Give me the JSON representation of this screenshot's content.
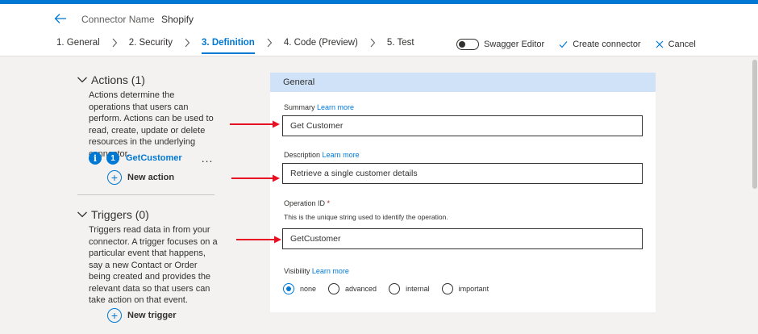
{
  "header": {
    "connector_name_label": "Connector Name",
    "connector_name_value": "Shopify"
  },
  "steps": [
    {
      "label": "1. General",
      "active": false
    },
    {
      "label": "2. Security",
      "active": false
    },
    {
      "label": "3. Definition",
      "active": true
    },
    {
      "label": "4. Code (Preview)",
      "active": false
    },
    {
      "label": "5. Test",
      "active": false
    }
  ],
  "toolbar": {
    "swagger_label": "Swagger Editor",
    "swagger_on": false,
    "create_label": "Create connector",
    "cancel_label": "Cancel"
  },
  "actions": {
    "title": "Actions (1)",
    "description": "Actions determine the operations that users can perform. Actions can be used to read, create, update or delete resources in the underlying connector.",
    "items": [
      {
        "number": "1",
        "name": "GetCustomer",
        "info_glyph": "i",
        "menu_glyph": "..."
      }
    ],
    "new_label": "New action"
  },
  "triggers": {
    "title": "Triggers (0)",
    "description": "Triggers read data in from your connector. A trigger focuses on a particular event that happens, say a new Contact or Order being created and provides the relevant data so that users can take action on that event.",
    "new_label": "New trigger"
  },
  "general": {
    "title": "General",
    "summary_label": "Summary",
    "summary_link": "Learn more",
    "summary_value": "Get Customer",
    "description_label": "Description",
    "description_link": "Learn more",
    "description_value": "Retrieve a single customer details",
    "operation_label": "Operation ID",
    "operation_required": "*",
    "operation_help": "This is the unique string used to identify the operation.",
    "operation_value": "GetCustomer",
    "visibility_label": "Visibility",
    "visibility_link": "Learn more",
    "visibility_options": [
      "none",
      "advanced",
      "internal",
      "important"
    ],
    "visibility_selected": "none"
  },
  "colors": {
    "accent": "#0078d4",
    "annotation_arrow": "#e81123",
    "panel_header": "#cfe2f8"
  },
  "icons": {
    "back": "arrow-left-icon",
    "step_separator": "chevron-right-icon",
    "create": "checkmark-icon",
    "cancel": "close-icon",
    "section_toggle": "chevron-down-icon",
    "add": "plus-circle-icon",
    "info": "info-icon",
    "annotation": "red-arrow-icon"
  }
}
